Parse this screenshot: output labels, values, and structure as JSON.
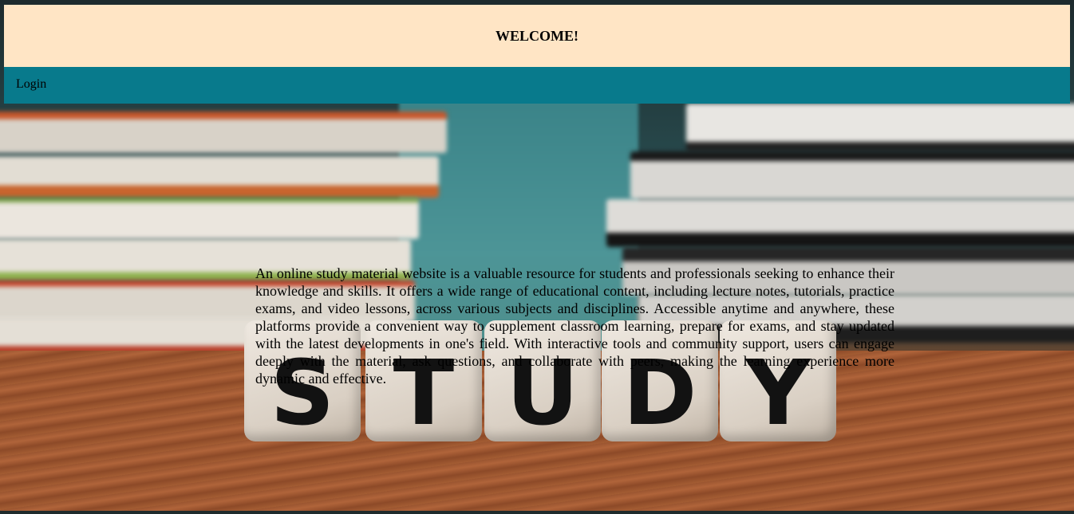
{
  "header": {
    "title": "WELCOME!",
    "background": "#ffe5c5"
  },
  "nav": {
    "login_label": "Login",
    "background": "#087a8c"
  },
  "main": {
    "description": "An online study material website is a valuable resource for students and professionals seeking to enhance their knowledge and skills. It offers a wide range of educational content, including lecture notes, tutorials, practice exams, and video lessons, across various subjects and disciplines. Accessible anytime and anywhere, these platforms provide a convenient way to supplement classroom learning, prepare for exams, and stay updated with the latest developments in one's field. With interactive tools and community support, users can engage deeply with the material, ask questions, and collaborate with peers, making the learning experience more dynamic and effective."
  },
  "background_image": {
    "dice_letters": [
      "S",
      "T",
      "U",
      "D",
      "Y"
    ]
  }
}
